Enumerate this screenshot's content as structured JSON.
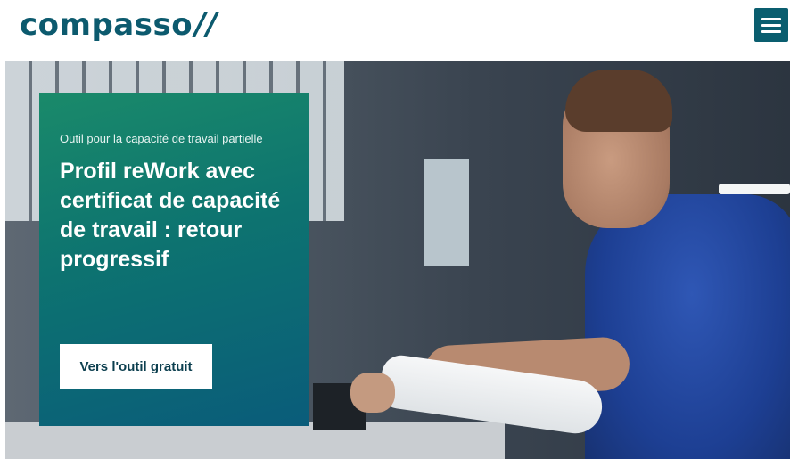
{
  "header": {
    "logo_text": "compasso",
    "logo_mark": "//",
    "menu_icon": "hamburger-menu-icon"
  },
  "hero": {
    "eyebrow": "Outil pour la capacité de travail partielle",
    "title": "Profil reWork avec certificat de capacité de travail : retour progressif",
    "cta_label": "Vers l'outil gratuit"
  },
  "colors": {
    "brand": "#0c5a6e",
    "menu_button": "#0a5e6f",
    "card_gradient_start": "#1a8a6a",
    "card_gradient_end": "#0a5c7a"
  }
}
